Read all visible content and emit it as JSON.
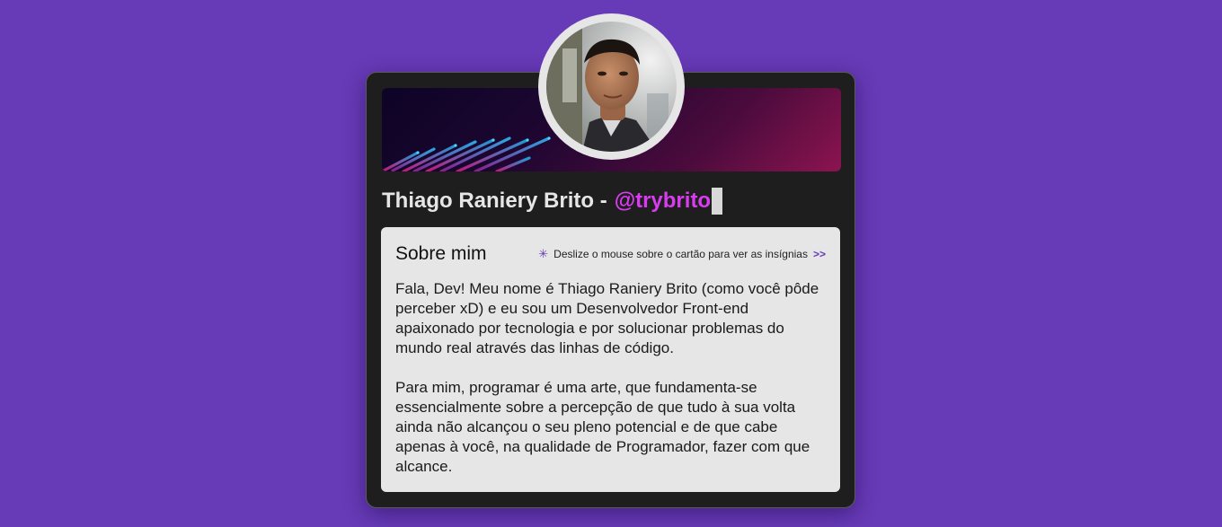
{
  "profile": {
    "name": "Thiago Raniery Brito -",
    "handle": "@trybrito",
    "avatar_icon": "profile-photo"
  },
  "about": {
    "title": "Sobre mim",
    "hint_icon": "asterisk",
    "hint": "Deslize o mouse sobre o cartão para ver as insígnias",
    "hint_arrows": ">>",
    "paragraphs": [
      "Fala, Dev! Meu nome é Thiago Raniery Brito (como você pôde perceber xD) e eu sou um Desenvolvedor Front-end apaixonado por tecnologia e por solucionar problemas do mundo real através das linhas de código.",
      "Para mim, programar é uma arte, que fundamenta-se essencialmente sobre a percepção de que tudo à sua volta ainda não alcançou o seu pleno potencial e de que cabe apenas à você, na qualidade de Programador, fazer com que alcance."
    ]
  },
  "colors": {
    "background": "#673ab7",
    "card": "#1e1e1e",
    "accent_handle": "#d93cf0",
    "panel": "#e6e6e6"
  }
}
